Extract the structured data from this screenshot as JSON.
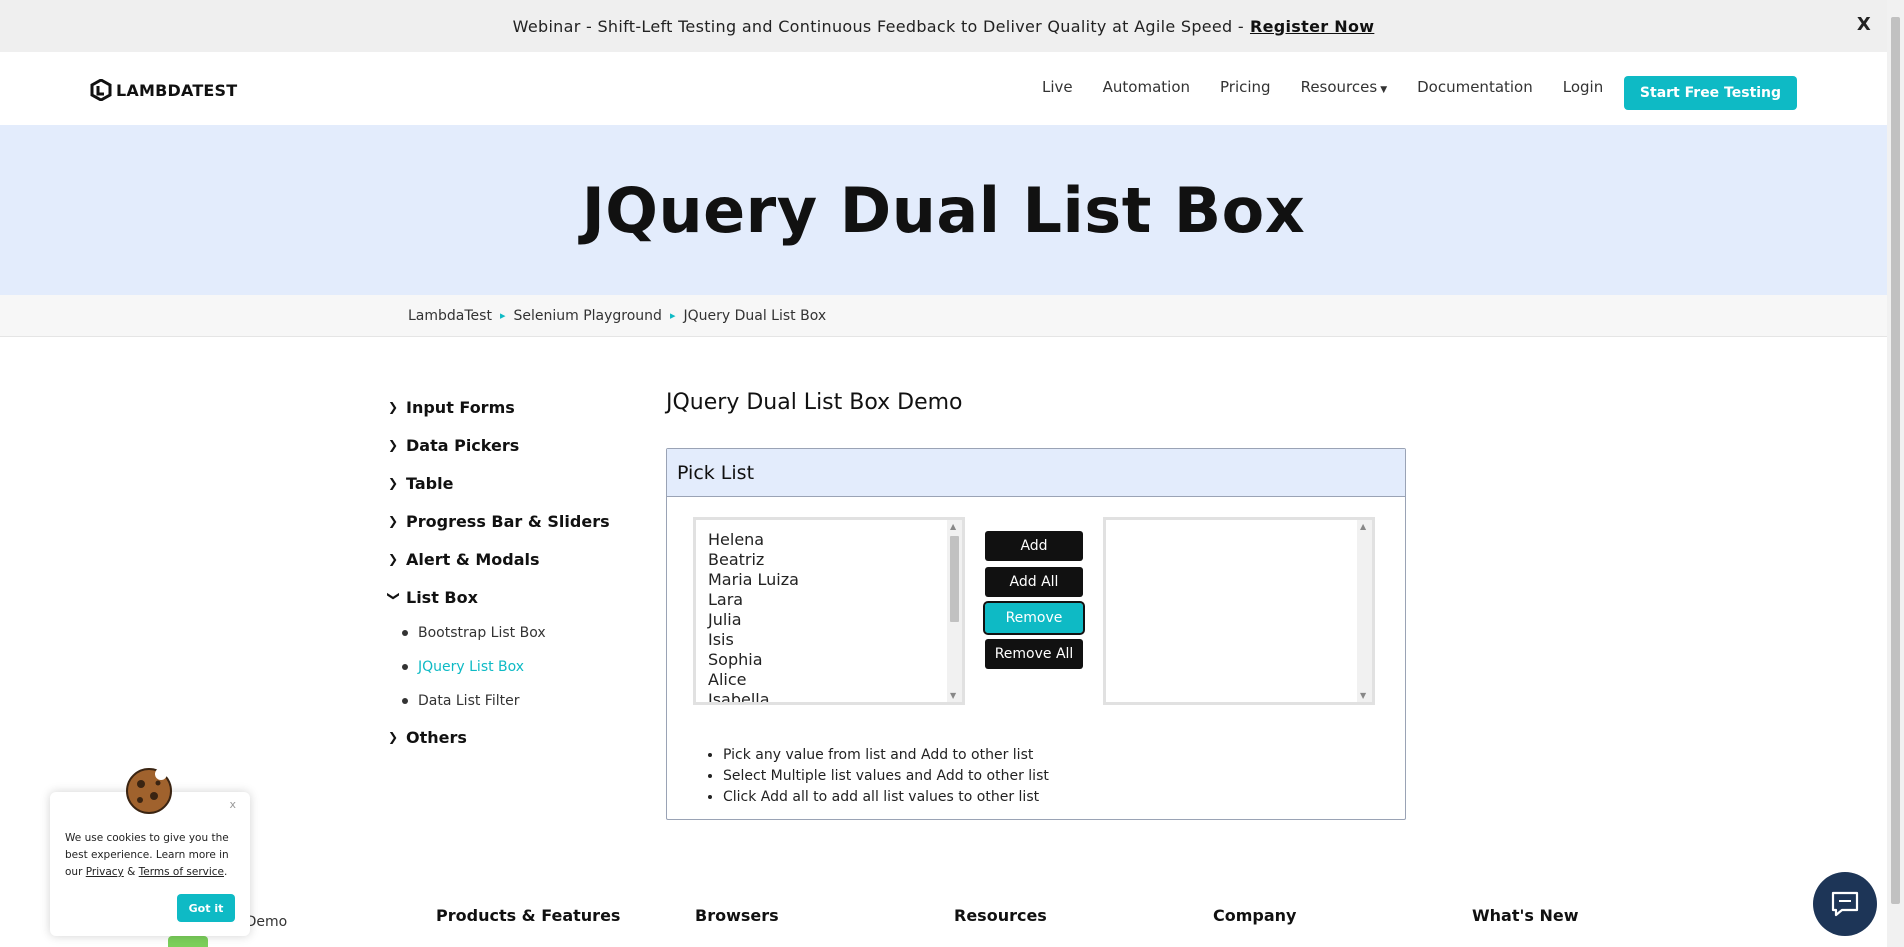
{
  "banner": {
    "text": "Webinar - Shift-Left Testing and Continuous Feedback to Deliver Quality at Agile Speed -",
    "link": "Register Now",
    "close": "X"
  },
  "nav": {
    "logo": "LAMBDATEST",
    "links": [
      "Live",
      "Automation",
      "Pricing",
      "Resources",
      "Documentation",
      "Login"
    ],
    "cta": "Start Free Testing"
  },
  "hero": {
    "title": "JQuery Dual List Box"
  },
  "breadcrumb": [
    "LambdaTest",
    "Selenium Playground",
    "JQuery Dual List Box"
  ],
  "sidebar": {
    "items": [
      "Input Forms",
      "Data Pickers",
      "Table",
      "Progress Bar & Sliders",
      "Alert & Modals",
      "List Box"
    ],
    "list_box_sub": [
      "Bootstrap List Box",
      "JQuery List Box",
      "Data List Filter"
    ],
    "last": "Others"
  },
  "main": {
    "demo_title": "JQuery Dual List Box Demo",
    "card_title": "Pick List",
    "left_options": [
      "Helena",
      "Beatriz",
      "Maria Luiza",
      "Lara",
      "Julia",
      "Isis",
      "Sophia",
      "Alice",
      "Isabella"
    ],
    "buttons": [
      "Add",
      "Add All",
      "Remove",
      "Remove All"
    ],
    "notes": [
      "Pick any value from list and Add to other list",
      "Select Multiple list values and Add to other list",
      "Click Add all to add all list values to other list"
    ]
  },
  "footer": {
    "columns": [
      "Products & Features",
      "Browsers",
      "Resources",
      "Company",
      "What's New"
    ],
    "book_demo": "k a Demo"
  },
  "cookie": {
    "line1": "We use cookies to give you the best experience. Learn more in our",
    "privacy": "Privacy",
    "amp": "&",
    "terms": "Terms of service",
    "period": ".",
    "close": "x",
    "button": "Got it"
  },
  "colors": {
    "accent": "#0ebac5",
    "hero_bg": "#e3ecfc",
    "chat": "#1d3557"
  }
}
